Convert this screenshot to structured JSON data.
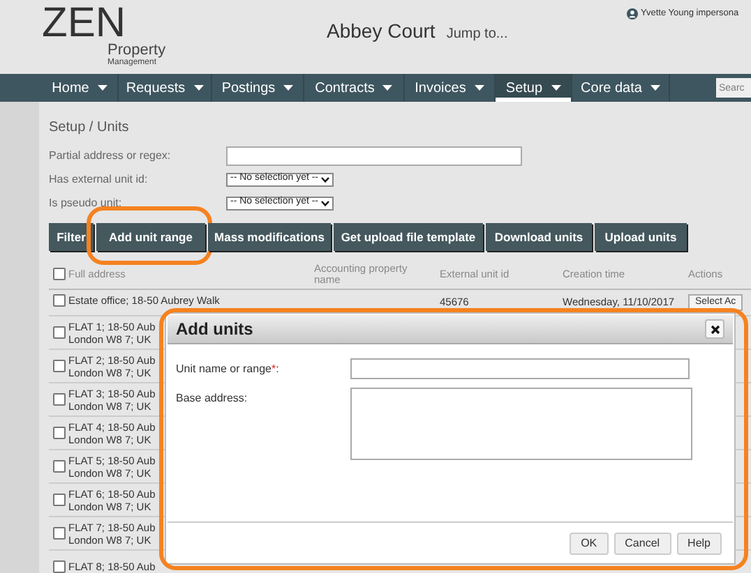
{
  "header": {
    "logo": {
      "main": "ZEN",
      "line_1": "Property",
      "line_2": "Management"
    },
    "property": "Abbey Court",
    "jump_to": "Jump to...",
    "user": "Yvette Young impersona"
  },
  "nav": {
    "items": [
      {
        "label": "Home",
        "selected": false
      },
      {
        "label": "Requests",
        "selected": false
      },
      {
        "label": "Postings",
        "selected": false
      },
      {
        "label": "Contracts",
        "selected": false
      },
      {
        "label": "Invoices",
        "selected": false
      },
      {
        "label": "Setup",
        "selected": true
      },
      {
        "label": "Core data",
        "selected": false
      }
    ],
    "search_placeholder": "Searc"
  },
  "breadcrumb": "Setup / Units",
  "filters": [
    {
      "kind": "text",
      "label": "Partial address or regex:"
    },
    {
      "kind": "select",
      "label": "Has external unit id:",
      "value": "-- No selection yet --"
    },
    {
      "kind": "select",
      "label": "Is pseudo unit:",
      "value": "-- No selection yet --"
    }
  ],
  "toolbar": [
    {
      "label": "Filter",
      "highlighted": false
    },
    {
      "label": "Add unit range",
      "highlighted": true
    },
    {
      "label": "Mass modifications",
      "highlighted": false
    },
    {
      "label": "Get upload file template",
      "highlighted": false
    },
    {
      "label": "Download units",
      "highlighted": false
    },
    {
      "label": "Upload units",
      "highlighted": false
    }
  ],
  "table": {
    "select_all_checked": false,
    "columns": [
      "Full address",
      "Accounting property name",
      "External unit id",
      "Creation time",
      "Actions"
    ],
    "rows": [
      {
        "checked": false,
        "address": [
          "Estate office; 18-50 Aubrey Walk"
        ],
        "external_id": "45676",
        "creation_time": "Wednesday, 11/10/2017",
        "action": "Select Ac"
      },
      {
        "checked": false,
        "address": [
          "FLAT 1; 18-50 Aub",
          "London W8 7; UK"
        ]
      },
      {
        "checked": false,
        "address": [
          "FLAT 2; 18-50 Aub",
          "London W8 7; UK"
        ]
      },
      {
        "checked": false,
        "address": [
          "FLAT 3; 18-50 Aub",
          "London W8 7; UK"
        ]
      },
      {
        "checked": false,
        "address": [
          "FLAT 4; 18-50 Aub",
          "London W8 7; UK"
        ]
      },
      {
        "checked": false,
        "address": [
          "FLAT 5; 18-50 Aub",
          "London W8 7; UK"
        ]
      },
      {
        "checked": false,
        "address": [
          "FLAT 6; 18-50 Aub",
          "London W8 7; UK"
        ]
      },
      {
        "checked": false,
        "address": [
          "FLAT 7; 18-50 Aub",
          "London W8 7; UK"
        ]
      },
      {
        "checked": false,
        "address": [
          "FLAT 8; 18-50 Aub"
        ]
      }
    ]
  },
  "dialog": {
    "title": "Add units",
    "highlighted": true,
    "fields": [
      {
        "kind": "input",
        "label": "Unit name or range",
        "required_mark": "*",
        "label_end": ":"
      },
      {
        "kind": "textarea",
        "label": "Base address:"
      }
    ],
    "buttons": [
      "OK",
      "Cancel",
      "Help"
    ]
  }
}
